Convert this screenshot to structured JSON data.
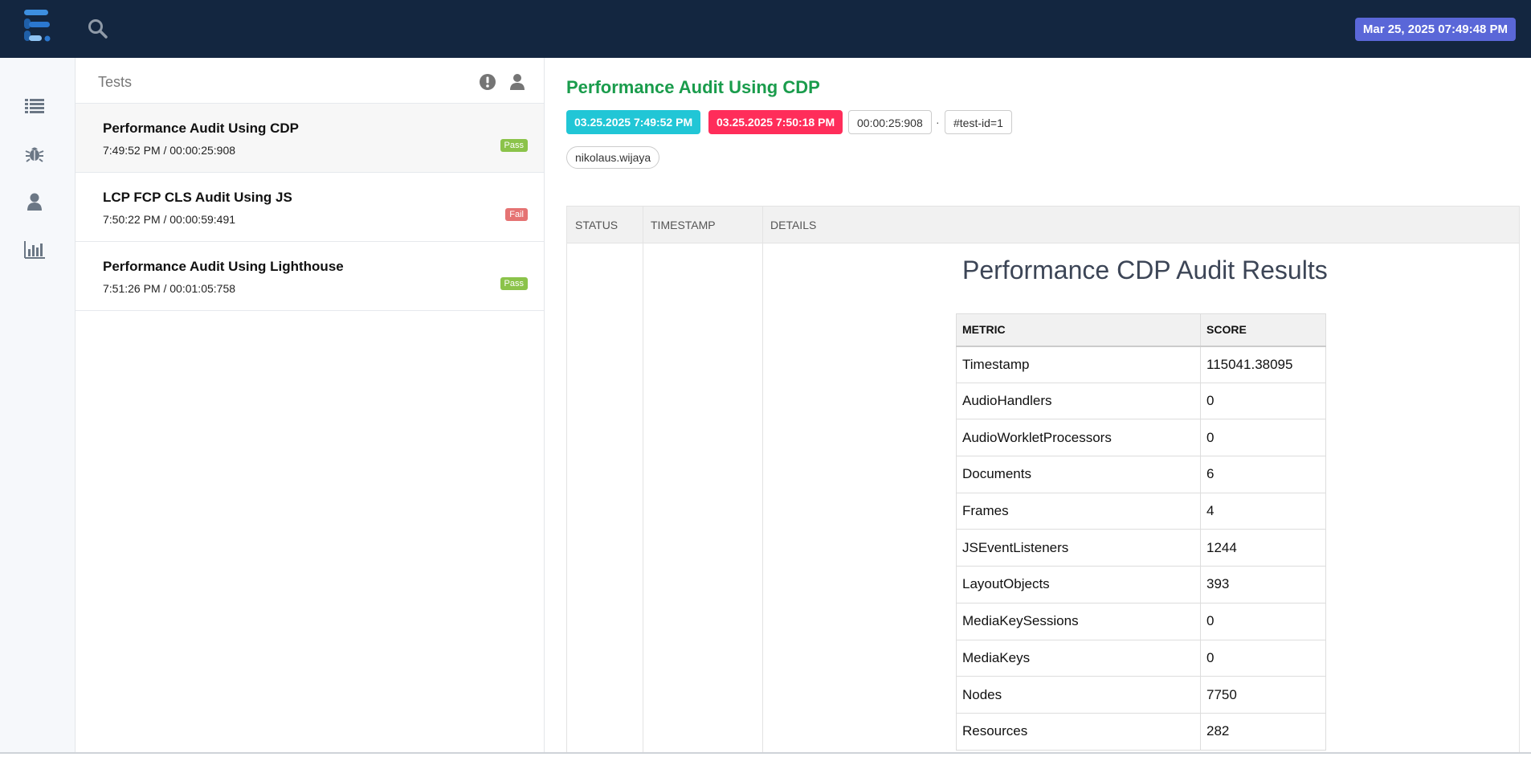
{
  "topbar": {
    "date": "Mar 25, 2025 07:49:48 PM",
    "logo_icon": "logo-icon",
    "search_icon": "search-icon"
  },
  "sidenav": {
    "items": [
      "list-icon",
      "bug-icon",
      "user-icon",
      "bar-chart-icon"
    ]
  },
  "tests": {
    "title": "Tests",
    "header_icons": [
      "exclamation-circle-icon",
      "user-icon"
    ],
    "items": [
      {
        "name": "Performance Audit Using CDP",
        "time": "7:49:52 PM / 00:00:25:908",
        "status": "Pass"
      },
      {
        "name": "LCP FCP CLS Audit Using JS",
        "time": "7:50:22 PM / 00:00:59:491",
        "status": "Fail"
      },
      {
        "name": "Performance Audit Using Lighthouse",
        "time": "7:51:26 PM / 00:01:05:758",
        "status": "Pass"
      }
    ]
  },
  "detail": {
    "title": "Performance Audit Using CDP",
    "start": "03.25.2025 7:49:52 PM",
    "end": "03.25.2025 7:50:18 PM",
    "duration": "00:00:25:908",
    "separator": "·",
    "test_id": "#test-id=1",
    "author": "nikolaus.wijaya",
    "log_columns": [
      "Status",
      "Timestamp",
      "Details"
    ],
    "results_title": "Performance CDP Audit Results",
    "metric_columns": [
      "METRIC",
      "SCORE"
    ],
    "metrics": [
      [
        "Timestamp",
        "115041.38095"
      ],
      [
        "AudioHandlers",
        "0"
      ],
      [
        "AudioWorkletProcessors",
        "0"
      ],
      [
        "Documents",
        "6"
      ],
      [
        "Frames",
        "4"
      ],
      [
        "JSEventListeners",
        "1244"
      ],
      [
        "LayoutObjects",
        "393"
      ],
      [
        "MediaKeySessions",
        "0"
      ],
      [
        "MediaKeys",
        "0"
      ],
      [
        "Nodes",
        "7750"
      ],
      [
        "Resources",
        "282"
      ]
    ]
  },
  "colors": {
    "topbar": "#132640",
    "date_badge": "#5a67d8",
    "pass": "#8bc34a",
    "fail": "#e57373",
    "title_green": "#1a9c4c",
    "start_chip": "#21c6d6",
    "end_chip": "#ff2d5a"
  }
}
